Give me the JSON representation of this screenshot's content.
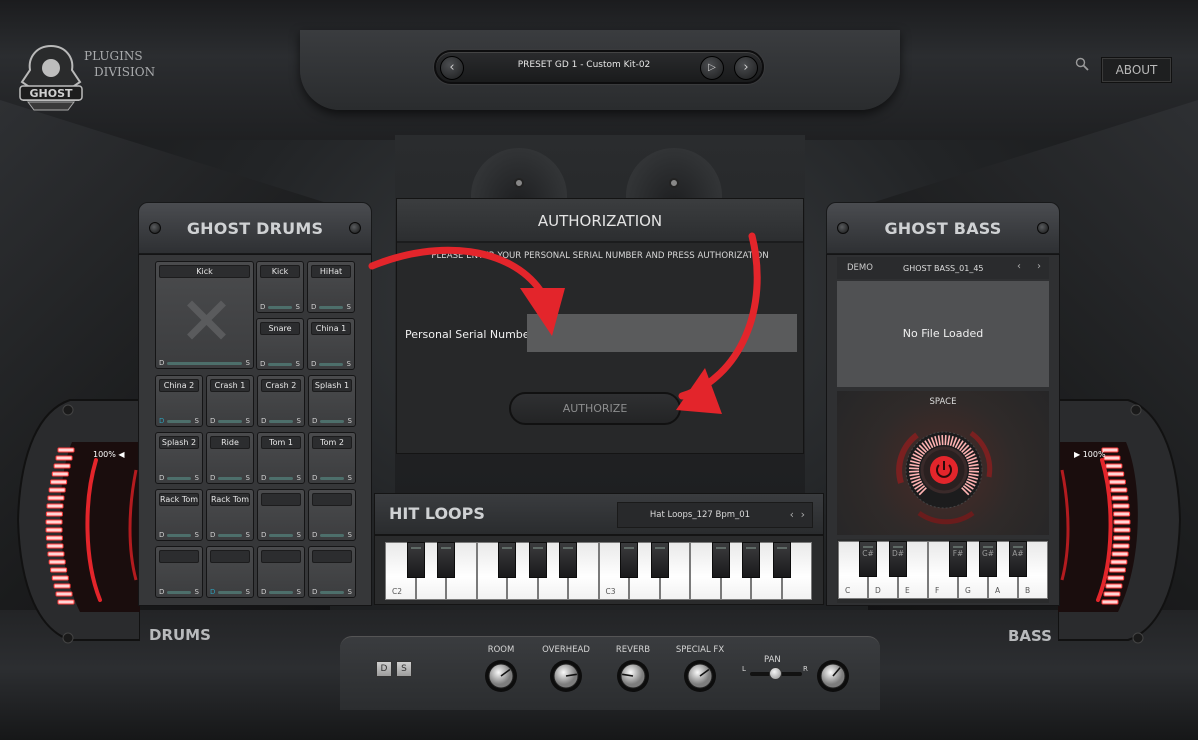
{
  "header": {
    "brand_line1": "PLUGINS",
    "brand_line2": "DIVISION",
    "logo_text": "GHOST",
    "preset_name": "PRESET GD 1 - Custom Kit-02",
    "prev_icon": "‹",
    "play_icon": "▷",
    "next_icon": "›",
    "about_label": "ABOUT"
  },
  "drums": {
    "title": "GHOST DRUMS",
    "section_label": "DRUMS",
    "d_label": "D",
    "s_label": "S",
    "big_pad": {
      "label": "Kick"
    },
    "pads": [
      {
        "label": "Kick"
      },
      {
        "label": "HiHat"
      },
      {
        "label": "Snare"
      },
      {
        "label": "China 1"
      },
      {
        "label": "China 2",
        "d_active": true
      },
      {
        "label": "Crash 1"
      },
      {
        "label": "Crash 2"
      },
      {
        "label": "Splash 1"
      },
      {
        "label": "Splash 2"
      },
      {
        "label": "Ride"
      },
      {
        "label": "Tom 1"
      },
      {
        "label": "Tom 2"
      },
      {
        "label": "Rack Tom 1"
      },
      {
        "label": "Rack Tom 2"
      },
      {
        "label": ""
      },
      {
        "label": ""
      },
      {
        "label": ""
      },
      {
        "label": "",
        "d_active": true
      },
      {
        "label": ""
      },
      {
        "label": ""
      }
    ]
  },
  "authorization": {
    "title": "AUTHORIZATION",
    "instruction": "PLEASE ENTER YOUR PERSONAL SERIAL NUMBER AND PRESS AUTHORIZATION",
    "serial_label": "Personal Serial Number",
    "serial_value": "",
    "serial_placeholder": "",
    "authorize_label": "AUTHORIZE",
    "annotation_color": "#e0191f"
  },
  "hit_loops": {
    "title": "HIT LOOPS",
    "selected_loop": "Hat Loops_127 Bpm_01",
    "prev_icon": "‹",
    "next_icon": "›",
    "octave_labels": [
      "C2",
      "C3"
    ]
  },
  "bass": {
    "title": "GHOST BASS",
    "section_label": "BASS",
    "mode_label": "DEMO",
    "preset_name": "GHOST BASS_01_45",
    "prev_icon": "‹",
    "next_icon": "›",
    "file_status": "No File Loaded",
    "space_label": "SPACE",
    "space_power": "on",
    "white_keys": [
      "C",
      "D",
      "E",
      "F",
      "G",
      "A",
      "B"
    ],
    "black_keys": [
      "C#",
      "D#",
      "F#",
      "G#",
      "A#"
    ]
  },
  "meters": {
    "left": {
      "label": "100%",
      "value_percent": 100,
      "icon": "◀"
    },
    "right": {
      "label": "100%",
      "value_percent": 100,
      "icon": "▶"
    }
  },
  "mixer": {
    "d_label": "D",
    "s_label": "S",
    "knobs": [
      {
        "label": "ROOM",
        "value": 0.7
      },
      {
        "label": "OVERHEAD",
        "value": 0.8
      },
      {
        "label": "REVERB",
        "value": 0.2
      },
      {
        "label": "SPECIAL FX",
        "value": 0.7
      }
    ],
    "pan": {
      "label": "PAN",
      "left_label": "L",
      "right_label": "R",
      "value": 0.0
    },
    "master_knob": {
      "value": 0.65
    }
  },
  "colors": {
    "accent_red": "#e3252b",
    "meter_glow": "#ff4a4a",
    "pad_active_d": "#2e9bb5"
  }
}
